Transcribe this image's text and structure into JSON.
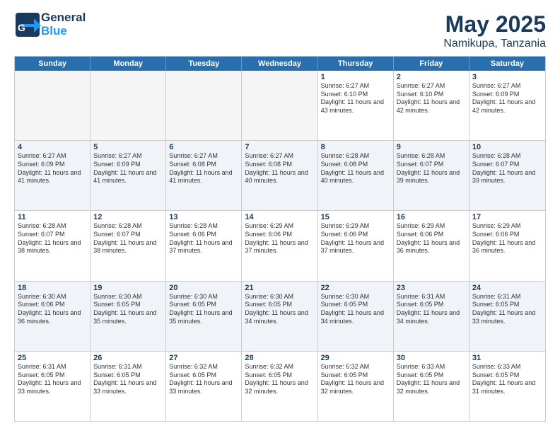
{
  "header": {
    "logo_line1": "General",
    "logo_line2": "Blue",
    "month": "May 2025",
    "location": "Namikupa, Tanzania"
  },
  "days_of_week": [
    "Sunday",
    "Monday",
    "Tuesday",
    "Wednesday",
    "Thursday",
    "Friday",
    "Saturday"
  ],
  "weeks": [
    [
      {
        "day": "",
        "empty": true
      },
      {
        "day": "",
        "empty": true
      },
      {
        "day": "",
        "empty": true
      },
      {
        "day": "",
        "empty": true
      },
      {
        "day": "1",
        "sunrise": "6:27 AM",
        "sunset": "6:10 PM",
        "daylight": "11 hours and 43 minutes."
      },
      {
        "day": "2",
        "sunrise": "6:27 AM",
        "sunset": "6:10 PM",
        "daylight": "11 hours and 42 minutes."
      },
      {
        "day": "3",
        "sunrise": "6:27 AM",
        "sunset": "6:09 PM",
        "daylight": "11 hours and 42 minutes."
      }
    ],
    [
      {
        "day": "4",
        "sunrise": "6:27 AM",
        "sunset": "6:09 PM",
        "daylight": "11 hours and 41 minutes."
      },
      {
        "day": "5",
        "sunrise": "6:27 AM",
        "sunset": "6:09 PM",
        "daylight": "11 hours and 41 minutes."
      },
      {
        "day": "6",
        "sunrise": "6:27 AM",
        "sunset": "6:08 PM",
        "daylight": "11 hours and 41 minutes."
      },
      {
        "day": "7",
        "sunrise": "6:27 AM",
        "sunset": "6:08 PM",
        "daylight": "11 hours and 40 minutes."
      },
      {
        "day": "8",
        "sunrise": "6:28 AM",
        "sunset": "6:08 PM",
        "daylight": "11 hours and 40 minutes."
      },
      {
        "day": "9",
        "sunrise": "6:28 AM",
        "sunset": "6:07 PM",
        "daylight": "11 hours and 39 minutes."
      },
      {
        "day": "10",
        "sunrise": "6:28 AM",
        "sunset": "6:07 PM",
        "daylight": "11 hours and 39 minutes."
      }
    ],
    [
      {
        "day": "11",
        "sunrise": "6:28 AM",
        "sunset": "6:07 PM",
        "daylight": "11 hours and 38 minutes."
      },
      {
        "day": "12",
        "sunrise": "6:28 AM",
        "sunset": "6:07 PM",
        "daylight": "11 hours and 38 minutes."
      },
      {
        "day": "13",
        "sunrise": "6:28 AM",
        "sunset": "6:06 PM",
        "daylight": "11 hours and 37 minutes."
      },
      {
        "day": "14",
        "sunrise": "6:29 AM",
        "sunset": "6:06 PM",
        "daylight": "11 hours and 37 minutes."
      },
      {
        "day": "15",
        "sunrise": "6:29 AM",
        "sunset": "6:06 PM",
        "daylight": "11 hours and 37 minutes."
      },
      {
        "day": "16",
        "sunrise": "6:29 AM",
        "sunset": "6:06 PM",
        "daylight": "11 hours and 36 minutes."
      },
      {
        "day": "17",
        "sunrise": "6:29 AM",
        "sunset": "6:06 PM",
        "daylight": "11 hours and 36 minutes."
      }
    ],
    [
      {
        "day": "18",
        "sunrise": "6:30 AM",
        "sunset": "6:06 PM",
        "daylight": "11 hours and 36 minutes."
      },
      {
        "day": "19",
        "sunrise": "6:30 AM",
        "sunset": "6:05 PM",
        "daylight": "11 hours and 35 minutes."
      },
      {
        "day": "20",
        "sunrise": "6:30 AM",
        "sunset": "6:05 PM",
        "daylight": "11 hours and 35 minutes."
      },
      {
        "day": "21",
        "sunrise": "6:30 AM",
        "sunset": "6:05 PM",
        "daylight": "11 hours and 34 minutes."
      },
      {
        "day": "22",
        "sunrise": "6:30 AM",
        "sunset": "6:05 PM",
        "daylight": "11 hours and 34 minutes."
      },
      {
        "day": "23",
        "sunrise": "6:31 AM",
        "sunset": "6:05 PM",
        "daylight": "11 hours and 34 minutes."
      },
      {
        "day": "24",
        "sunrise": "6:31 AM",
        "sunset": "6:05 PM",
        "daylight": "11 hours and 33 minutes."
      }
    ],
    [
      {
        "day": "25",
        "sunrise": "6:31 AM",
        "sunset": "6:05 PM",
        "daylight": "11 hours and 33 minutes."
      },
      {
        "day": "26",
        "sunrise": "6:31 AM",
        "sunset": "6:05 PM",
        "daylight": "11 hours and 33 minutes."
      },
      {
        "day": "27",
        "sunrise": "6:32 AM",
        "sunset": "6:05 PM",
        "daylight": "11 hours and 33 minutes."
      },
      {
        "day": "28",
        "sunrise": "6:32 AM",
        "sunset": "6:05 PM",
        "daylight": "11 hours and 32 minutes."
      },
      {
        "day": "29",
        "sunrise": "6:32 AM",
        "sunset": "6:05 PM",
        "daylight": "11 hours and 32 minutes."
      },
      {
        "day": "30",
        "sunrise": "6:33 AM",
        "sunset": "6:05 PM",
        "daylight": "11 hours and 32 minutes."
      },
      {
        "day": "31",
        "sunrise": "6:33 AM",
        "sunset": "6:05 PM",
        "daylight": "11 hours and 31 minutes."
      }
    ]
  ]
}
